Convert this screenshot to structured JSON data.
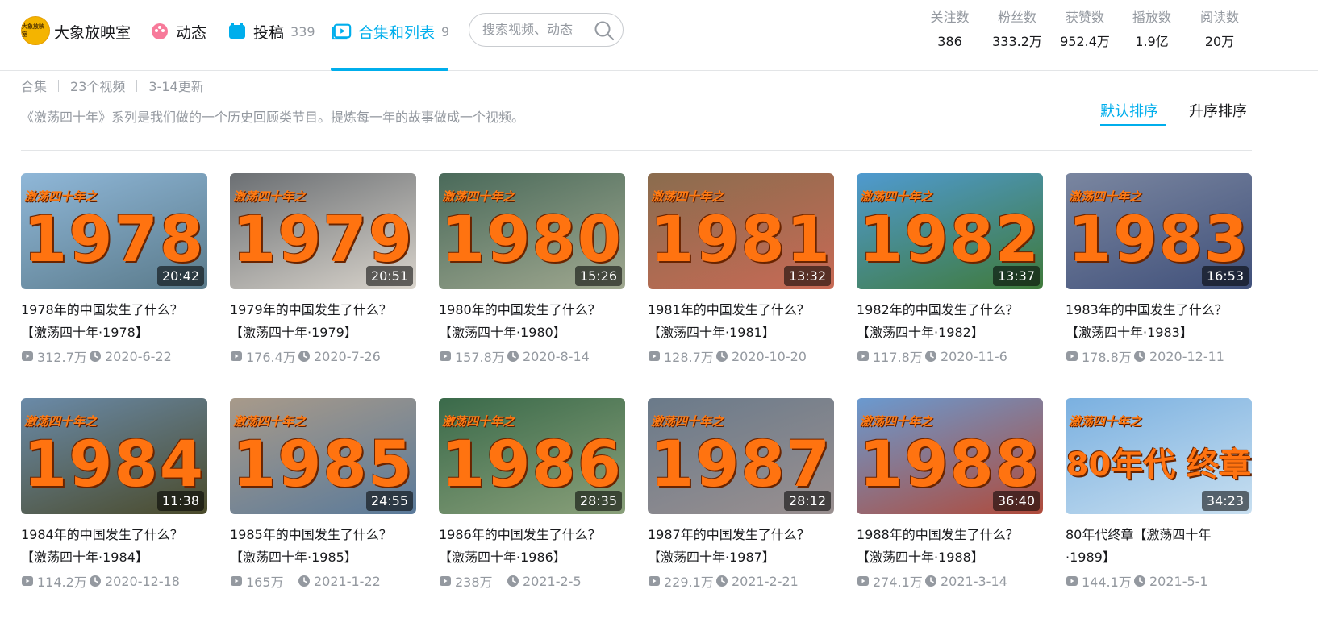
{
  "header": {
    "avatar_text": "大象放映室",
    "channel_name": "大象放映室",
    "nav": [
      {
        "label": "动态",
        "count": ""
      },
      {
        "label": "投稿",
        "count": "339"
      },
      {
        "label": "合集和列表",
        "count": "9"
      }
    ],
    "search_placeholder": "搜索视频、动态",
    "stats": [
      {
        "label": "关注数",
        "value": "386"
      },
      {
        "label": "粉丝数",
        "value": "333.2万"
      },
      {
        "label": "获赞数",
        "value": "952.4万"
      },
      {
        "label": "播放数",
        "value": "1.9亿"
      },
      {
        "label": "阅读数",
        "value": "20万"
      }
    ],
    "accent_color": "#00aeec"
  },
  "collection": {
    "type": "合集",
    "video_count": "23个视频",
    "updated": "3-14更新",
    "description": "《激荡四十年》系列是我们做的一个历史回顾类节目。提炼每一年的故事做成一个视频。",
    "sort_default": "默认排序",
    "sort_asc": "升序排序"
  },
  "videos": [
    {
      "series": "激荡四十年之",
      "year": "1978",
      "duration": "20:42",
      "title": "1978年的中国发生了什么？【激荡四十年·1978】",
      "plays": "312.7万",
      "date": "2020-6-22"
    },
    {
      "series": "激荡四十年之",
      "year": "1979",
      "duration": "20:51",
      "title": "1979年的中国发生了什么？【激荡四十年·1979】",
      "plays": "176.4万",
      "date": "2020-7-26"
    },
    {
      "series": "激荡四十年之",
      "year": "1980",
      "duration": "15:26",
      "title": "1980年的中国发生了什么？【激荡四十年·1980】",
      "plays": "157.8万",
      "date": "2020-8-14"
    },
    {
      "series": "激荡四十年之",
      "year": "1981",
      "duration": "13:32",
      "title": "1981年的中国发生了什么？【激荡四十年·1981】",
      "plays": "128.7万",
      "date": "2020-10-20"
    },
    {
      "series": "激荡四十年之",
      "year": "1982",
      "duration": "13:37",
      "title": "1982年的中国发生了什么？【激荡四十年·1982】",
      "plays": "117.8万",
      "date": "2020-11-6"
    },
    {
      "series": "激荡四十年之",
      "year": "1983",
      "duration": "16:53",
      "title": "1983年的中国发生了什么？【激荡四十年·1983】",
      "plays": "178.8万",
      "date": "2020-12-11"
    },
    {
      "series": "激荡四十年之",
      "year": "1984",
      "duration": "11:38",
      "title": "1984年的中国发生了什么？【激荡四十年·1984】",
      "plays": "114.2万",
      "date": "2020-12-18"
    },
    {
      "series": "激荡四十年之",
      "year": "1985",
      "duration": "24:55",
      "title": "1985年的中国发生了什么？【激荡四十年·1985】",
      "plays": "165万",
      "date": "2021-1-22"
    },
    {
      "series": "激荡四十年之",
      "year": "1986",
      "duration": "28:35",
      "title": "1986年的中国发生了什么？【激荡四十年·1986】",
      "plays": "238万",
      "date": "2021-2-5"
    },
    {
      "series": "激荡四十年之",
      "year": "1987",
      "duration": "28:12",
      "title": "1987年的中国发生了什么？【激荡四十年·1987】",
      "plays": "229.1万",
      "date": "2021-2-21"
    },
    {
      "series": "激荡四十年之",
      "year": "1988",
      "duration": "36:40",
      "title": "1988年的中国发生了什么？【激荡四十年·1988】",
      "plays": "274.1万",
      "date": "2021-3-14"
    },
    {
      "series": "激荡四十年之",
      "year": "80年代 终章",
      "duration": "34:23",
      "title": "80年代终章【激荡四十年·1989】",
      "plays": "144.1万",
      "date": "2021-5-1"
    }
  ],
  "thumb_colors": [
    [
      "#8fb7d8",
      "#5a7a8a"
    ],
    [
      "#6b6f73",
      "#d9d4cc"
    ],
    [
      "#4a6a5a",
      "#a0a890"
    ],
    [
      "#8a6c4e",
      "#c86a55"
    ],
    [
      "#4f9ad0",
      "#3f7a3a"
    ],
    [
      "#7a86a0",
      "#40507a"
    ],
    [
      "#6a8aa8",
      "#4a4a2a"
    ],
    [
      "#a89a8a",
      "#5a7a9a"
    ],
    [
      "#3a6a4a",
      "#8aa07a"
    ],
    [
      "#6a7a8a",
      "#9a9090"
    ],
    [
      "#6a9ad0",
      "#b04a3a"
    ],
    [
      "#7ab0e0",
      "#c8dff0"
    ]
  ]
}
